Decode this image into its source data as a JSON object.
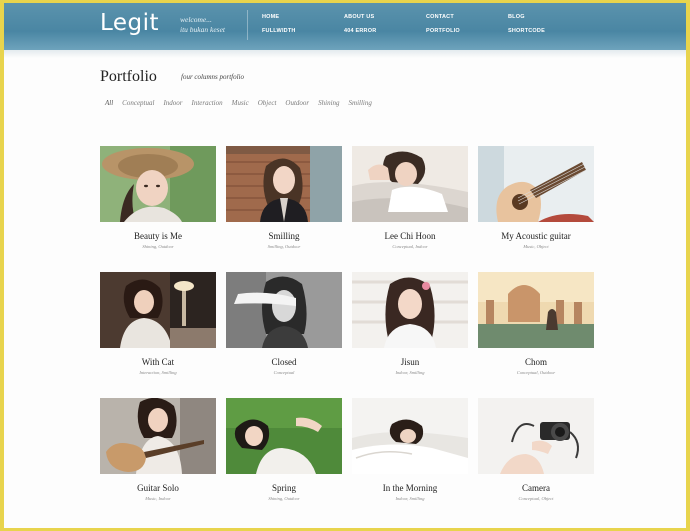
{
  "header": {
    "logo": "Legit",
    "tagline_line1": "welcome...",
    "tagline_line2": "itu bukan keset",
    "nav": [
      {
        "label": "HOME"
      },
      {
        "label": "FULLWIDTH"
      },
      {
        "label": "ABOUT US"
      },
      {
        "label": "404 ERROR"
      },
      {
        "label": "CONTACT"
      },
      {
        "label": "PORTFOLIO"
      },
      {
        "label": "BLOG"
      },
      {
        "label": "SHORTCODE"
      }
    ]
  },
  "page": {
    "title": "Portfolio",
    "subtitle": "four columns portfolio"
  },
  "filters": [
    "All",
    "Conceptual",
    "Indoor",
    "Interaction",
    "Music",
    "Object",
    "Outdoor",
    "Shining",
    "Smilling"
  ],
  "items": [
    {
      "title": "Beauty is Me",
      "tags": "Shining, Outdoor",
      "icon": "photo-woman-straw-hat"
    },
    {
      "title": "Smilling",
      "tags": "Smilling, Outdoor",
      "icon": "photo-woman-leather-jacket"
    },
    {
      "title": "Lee Chi Hoon",
      "tags": "Conceptual, Indoor",
      "icon": "photo-man-lying-in-bed"
    },
    {
      "title": "My Acoustic guitar",
      "tags": "Music, Object",
      "icon": "photo-acoustic-guitar"
    },
    {
      "title": "With Cat",
      "tags": "Interaction, Smilling",
      "icon": "photo-woman-at-desk"
    },
    {
      "title": "Closed",
      "tags": "Conceptual",
      "icon": "photo-blindfolded-woman"
    },
    {
      "title": "Jisun",
      "tags": "Indoor, Smilling",
      "icon": "photo-woman-portrait"
    },
    {
      "title": "Chom",
      "tags": "Conceptual, Outdoor",
      "icon": "photo-palace-lake"
    },
    {
      "title": "Guitar Solo",
      "tags": "Music, Indoor",
      "icon": "photo-woman-with-guitar"
    },
    {
      "title": "Spring",
      "tags": "Shining, Outdoor",
      "icon": "photo-girl-on-grass"
    },
    {
      "title": "In the Morning",
      "tags": "Indoor, Smilling",
      "icon": "photo-woman-in-white-bed"
    },
    {
      "title": "Camera",
      "tags": "Conceptual, Object",
      "icon": "photo-hands-with-camera"
    }
  ],
  "colors": {
    "header": "#4a86a3",
    "frame": "#e8d44d"
  }
}
